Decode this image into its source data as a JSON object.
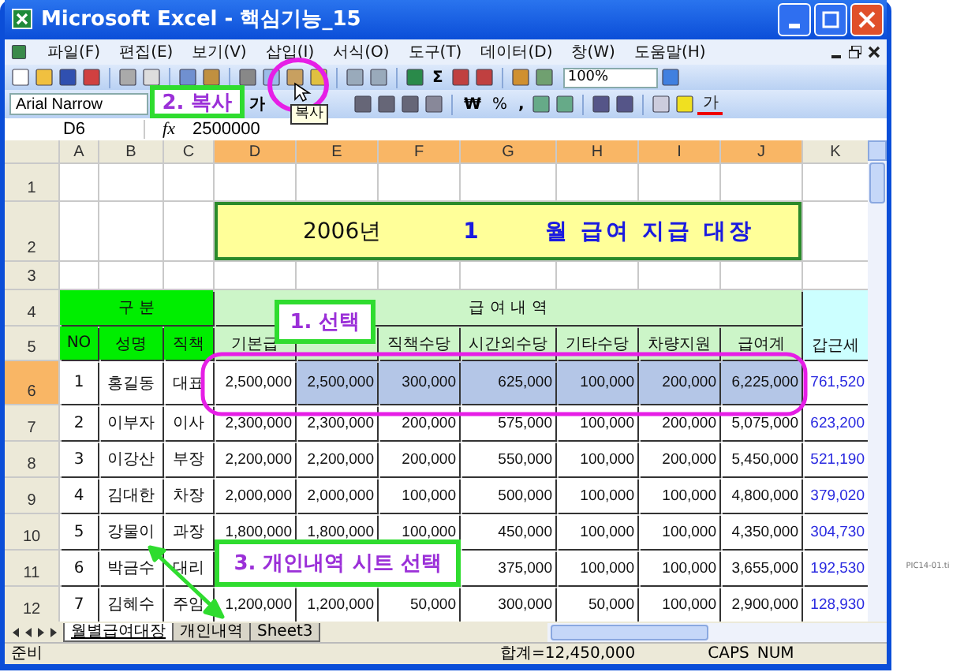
{
  "window": {
    "title": "Microsoft Excel - 핵심기능_15"
  },
  "menu": [
    "파일(F)",
    "편집(E)",
    "보기(V)",
    "삽입(I)",
    "서식(O)",
    "도구(T)",
    "데이터(D)",
    "창(W)",
    "도움말(H)"
  ],
  "toolbar": {
    "autosum": "Σ",
    "zoom": "100%"
  },
  "formatting": {
    "font": "Arial Narrow",
    "bold": "가",
    "currency": "₩",
    "percent": "%",
    "comma": ",",
    "font_color": "가"
  },
  "formula_bar": {
    "name_box": "D6",
    "function_label": "fx",
    "value": "2500000"
  },
  "sheet": {
    "columns": [
      {
        "label": "A",
        "selected": false
      },
      {
        "label": "B",
        "selected": false
      },
      {
        "label": "C",
        "selected": false
      },
      {
        "label": "D",
        "selected": true
      },
      {
        "label": "E",
        "selected": true
      },
      {
        "label": "F",
        "selected": true
      },
      {
        "label": "G",
        "selected": true
      },
      {
        "label": "H",
        "selected": true
      },
      {
        "label": "I",
        "selected": true
      },
      {
        "label": "J",
        "selected": true
      },
      {
        "label": "K",
        "selected": false
      }
    ],
    "row_headers": [
      {
        "label": "1",
        "selected": false
      },
      {
        "label": "2",
        "selected": false
      },
      {
        "label": "3",
        "selected": false
      },
      {
        "label": "4",
        "selected": false
      },
      {
        "label": "5",
        "selected": false
      },
      {
        "label": "6",
        "selected": true
      },
      {
        "label": "7",
        "selected": false
      },
      {
        "label": "8",
        "selected": false
      },
      {
        "label": "9",
        "selected": false
      },
      {
        "label": "10",
        "selected": false
      },
      {
        "label": "11",
        "selected": false
      },
      {
        "label": "12",
        "selected": false
      }
    ],
    "title": {
      "year": "2006년",
      "month": "1",
      "text": "월 급여 지급 대장"
    },
    "group_headers": [
      "구  분",
      "급        여        내        역"
    ],
    "tax_header": "갑근세",
    "field_headers_left": [
      "NO",
      "성명",
      "직책",
      "기본급"
    ],
    "field_headers_right": [
      "직책수당",
      "시간외수당",
      "기타수당",
      "차량지원",
      "급여계"
    ],
    "records": [
      {
        "no": "1",
        "name": "홍길동",
        "position": "대표",
        "values": [
          "2,500,000",
          "2,500,000",
          "300,000",
          "625,000",
          "100,000",
          "200,000",
          "6,225,000"
        ],
        "tax": "761,520"
      },
      {
        "no": "2",
        "name": "이부자",
        "position": "이사",
        "values": [
          "2,300,000",
          "2,300,000",
          "200,000",
          "575,000",
          "100,000",
          "200,000",
          "5,075,000"
        ],
        "tax": "623,200"
      },
      {
        "no": "3",
        "name": "이강산",
        "position": "부장",
        "values": [
          "2,200,000",
          "2,200,000",
          "200,000",
          "550,000",
          "100,000",
          "200,000",
          "5,450,000"
        ],
        "tax": "521,190"
      },
      {
        "no": "4",
        "name": "김대한",
        "position": "차장",
        "values": [
          "2,000,000",
          "2,000,000",
          "100,000",
          "500,000",
          "100,000",
          "100,000",
          "4,800,000"
        ],
        "tax": "379,020"
      },
      {
        "no": "5",
        "name": "강물이",
        "position": "과장",
        "values": [
          "1,800,000",
          "1,800,000",
          "100,000",
          "450,000",
          "100,000",
          "100,000",
          "4,350,000"
        ],
        "tax": "304,730"
      },
      {
        "no": "6",
        "name": "박금수",
        "position": "대리",
        "values": [
          "375,000",
          "100,000",
          "100,000",
          "3,655,000"
        ],
        "tax": "192,530"
      },
      {
        "no": "7",
        "name": "김혜수",
        "position": "주임",
        "values": [
          "1,200,000",
          "1,200,000",
          "50,000",
          "300,000",
          "50,000",
          "100,000",
          "2,900,000"
        ],
        "tax": "128,930"
      }
    ]
  },
  "sheet_tabs": [
    {
      "label": "월별급여대장",
      "selected": true
    },
    {
      "label": "개인내역",
      "selected": false
    },
    {
      "label": "Sheet3",
      "selected": false
    }
  ],
  "status_bar": {
    "mode": "준비",
    "sum": "합계=12,450,000",
    "indicators": [
      "CAPS",
      "NUM"
    ]
  },
  "annotations": {
    "callouts": [
      "1. 선택",
      "2. 복사",
      "3. 개인내역 시트 선택"
    ],
    "tooltip": "복사"
  },
  "caption": "PIC14-01.ti"
}
